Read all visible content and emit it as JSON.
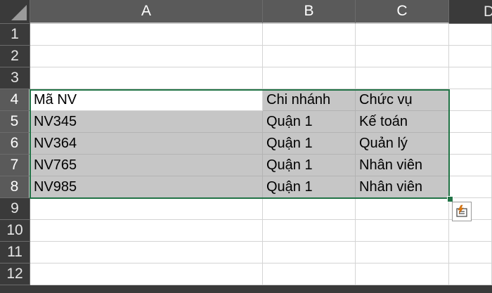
{
  "columns": [
    "A",
    "B",
    "C",
    "D"
  ],
  "rows": [
    "1",
    "2",
    "3",
    "4",
    "5",
    "6",
    "7",
    "8",
    "9",
    "10",
    "11",
    "12"
  ],
  "table": {
    "header": [
      "Mã NV",
      "Chi nhánh",
      "Chức vụ"
    ],
    "records": [
      [
        "NV345",
        "Quận 1",
        "Kế toán"
      ],
      [
        "NV364",
        "Quận 1",
        "Quản lý"
      ],
      [
        "NV765",
        "Quận 1",
        "Nhân viên"
      ],
      [
        "NV985",
        "Quận 1",
        "Nhân viên"
      ]
    ]
  },
  "colors": {
    "selection_border": "#217346",
    "selection_fill": "#c6c6c6",
    "header_bg": "#3a3a3a"
  },
  "quick_analysis_icon": "quick-analysis-icon"
}
